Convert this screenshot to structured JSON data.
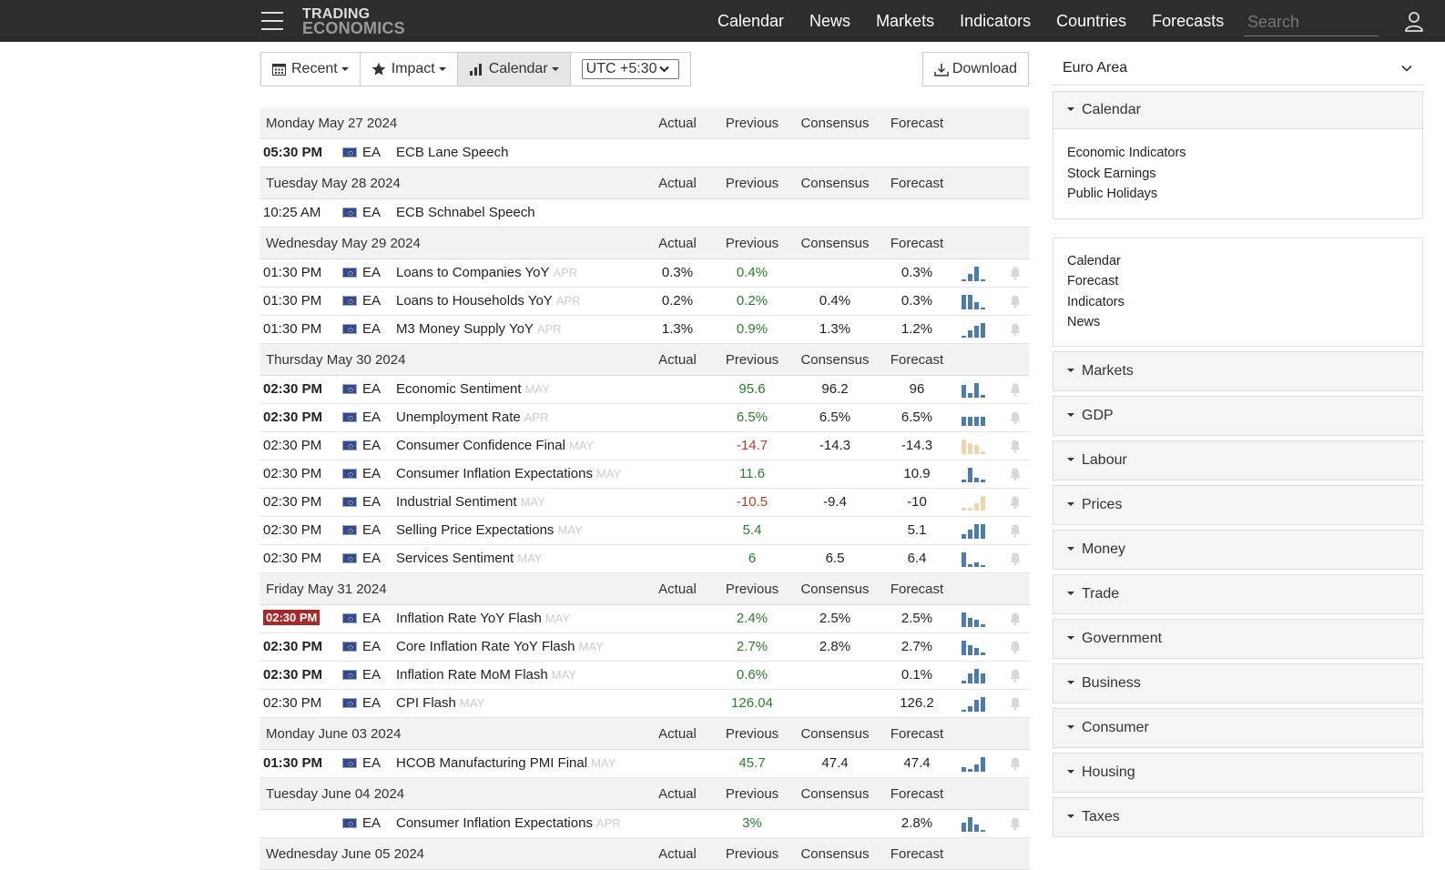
{
  "nav": {
    "logo_line1": "TRADING",
    "logo_line2": "ECONOMICS",
    "links": [
      "Calendar",
      "News",
      "Markets",
      "Indicators",
      "Countries",
      "Forecasts"
    ],
    "search_placeholder": "Search"
  },
  "toolbar": {
    "recent": "Recent",
    "impact": "Impact",
    "calendar": "Calendar",
    "timezone": "UTC +5:30",
    "download": "Download"
  },
  "columns": {
    "actual": "Actual",
    "previous": "Previous",
    "consensus": "Consensus",
    "forecast": "Forecast"
  },
  "days": [
    {
      "date": "Monday May 27 2024",
      "events": [
        {
          "time": "05:30 PM",
          "bold": true,
          "cc": "EA",
          "name": "ECB Lane Speech",
          "ref": "",
          "actual": "",
          "previous": "",
          "prev_color": "",
          "consensus": "",
          "forecast": "",
          "spark": [],
          "spark_neg": false,
          "bell": false
        }
      ]
    },
    {
      "date": "Tuesday May 28 2024",
      "events": [
        {
          "time": "10:25 AM",
          "bold": false,
          "cc": "EA",
          "name": "ECB Schnabel Speech",
          "ref": "",
          "actual": "",
          "previous": "",
          "prev_color": "",
          "consensus": "",
          "forecast": "",
          "spark": [],
          "spark_neg": false,
          "bell": false
        }
      ]
    },
    {
      "date": "Wednesday May 29 2024",
      "events": [
        {
          "time": "01:30 PM",
          "bold": false,
          "cc": "EA",
          "name": "Loans to Companies YoY",
          "ref": "APR",
          "actual": "0.3%",
          "previous": "0.4%",
          "prev_color": "green",
          "consensus": "",
          "forecast": "0.3%",
          "spark": [
            0.15,
            0.5,
            1,
            0.1
          ],
          "spark_neg": false,
          "bell": true
        },
        {
          "time": "01:30 PM",
          "bold": false,
          "cc": "EA",
          "name": "Loans to Households YoY",
          "ref": "APR",
          "actual": "0.2%",
          "previous": "0.2%",
          "prev_color": "green",
          "consensus": "0.4%",
          "forecast": "0.3%",
          "spark": [
            1,
            1,
            0.5,
            0.1
          ],
          "spark_neg": false,
          "bell": true
        },
        {
          "time": "01:30 PM",
          "bold": false,
          "cc": "EA",
          "name": "M3 Money Supply YoY",
          "ref": "APR",
          "actual": "1.3%",
          "previous": "0.9%",
          "prev_color": "green",
          "consensus": "1.3%",
          "forecast": "1.2%",
          "spark": [
            0.1,
            0.5,
            0.8,
            1
          ],
          "spark_neg": false,
          "bell": true
        }
      ]
    },
    {
      "date": "Thursday May 30 2024",
      "events": [
        {
          "time": "02:30 PM",
          "bold": true,
          "cc": "EA",
          "name": "Economic Sentiment",
          "ref": "MAY",
          "actual": "",
          "previous": "95.6",
          "prev_color": "green",
          "consensus": "96.2",
          "forecast": "96",
          "spark": [
            0.9,
            0.3,
            1,
            0.2
          ],
          "spark_neg": false,
          "bell": true
        },
        {
          "time": "02:30 PM",
          "bold": true,
          "cc": "EA",
          "name": "Unemployment Rate",
          "ref": "APR",
          "actual": "",
          "previous": "6.5%",
          "prev_color": "green",
          "consensus": "6.5%",
          "forecast": "6.5%",
          "spark": [
            0.6,
            0.6,
            0.6,
            0.6
          ],
          "spark_neg": false,
          "bell": true
        },
        {
          "time": "02:30 PM",
          "bold": false,
          "cc": "EA",
          "name": "Consumer Confidence Final",
          "ref": "MAY",
          "actual": "",
          "previous": "-14.7",
          "prev_color": "red",
          "consensus": "-14.3",
          "forecast": "-14.3",
          "spark": [
            1,
            0.75,
            0.6,
            0.2
          ],
          "spark_neg": true,
          "bell": true
        },
        {
          "time": "02:30 PM",
          "bold": false,
          "cc": "EA",
          "name": "Consumer Inflation Expectations",
          "ref": "MAY",
          "actual": "",
          "previous": "11.6",
          "prev_color": "green",
          "consensus": "",
          "forecast": "10.9",
          "spark": [
            0.2,
            1,
            0.3,
            0.2
          ],
          "spark_neg": false,
          "bell": true
        },
        {
          "time": "02:30 PM",
          "bold": false,
          "cc": "EA",
          "name": "Industrial Sentiment",
          "ref": "MAY",
          "actual": "",
          "previous": "-10.5",
          "prev_color": "red",
          "consensus": "-9.4",
          "forecast": "-10",
          "spark": [
            0.2,
            0.2,
            0.5,
            1
          ],
          "spark_neg": true,
          "bell": true
        },
        {
          "time": "02:30 PM",
          "bold": false,
          "cc": "EA",
          "name": "Selling Price Expectations",
          "ref": "MAY",
          "actual": "",
          "previous": "5.4",
          "prev_color": "green",
          "consensus": "",
          "forecast": "5.1",
          "spark": [
            0.3,
            0.6,
            1,
            1
          ],
          "spark_neg": false,
          "bell": true
        },
        {
          "time": "02:30 PM",
          "bold": false,
          "cc": "EA",
          "name": "Services Sentiment",
          "ref": "MAY",
          "actual": "",
          "previous": "6",
          "prev_color": "green",
          "consensus": "6.5",
          "forecast": "6.4",
          "spark": [
            1,
            0.2,
            0.3,
            0.1
          ],
          "spark_neg": false,
          "bell": true
        }
      ]
    },
    {
      "date": "Friday May 31 2024",
      "events": [
        {
          "time": "02:30 PM",
          "bold": true,
          "highlight": true,
          "cc": "EA",
          "name": "Inflation Rate YoY Flash",
          "ref": "MAY",
          "actual": "",
          "previous": "2.4%",
          "prev_color": "green",
          "consensus": "2.5%",
          "forecast": "2.5%",
          "spark": [
            1,
            0.6,
            0.5,
            0.2
          ],
          "spark_neg": false,
          "bell": true
        },
        {
          "time": "02:30 PM",
          "bold": true,
          "cc": "EA",
          "name": "Core Inflation Rate YoY Flash",
          "ref": "MAY",
          "actual": "",
          "previous": "2.7%",
          "prev_color": "green",
          "consensus": "2.8%",
          "forecast": "2.7%",
          "spark": [
            1,
            0.7,
            0.5,
            0.2
          ],
          "spark_neg": false,
          "bell": true
        },
        {
          "time": "02:30 PM",
          "bold": true,
          "cc": "EA",
          "name": "Inflation Rate MoM Flash",
          "ref": "MAY",
          "actual": "",
          "previous": "0.6%",
          "prev_color": "green",
          "consensus": "",
          "forecast": "0.1%",
          "spark": [
            0.2,
            0.7,
            1,
            0.7
          ],
          "spark_neg": false,
          "bell": true
        },
        {
          "time": "02:30 PM",
          "bold": false,
          "cc": "EA",
          "name": "CPI Flash",
          "ref": "MAY",
          "actual": "",
          "previous": "126.04",
          "prev_color": "green",
          "consensus": "",
          "forecast": "126.2",
          "spark": [
            0.1,
            0.4,
            0.8,
            1
          ],
          "spark_neg": false,
          "bell": true
        }
      ]
    },
    {
      "date": "Monday June 03 2024",
      "events": [
        {
          "time": "01:30 PM",
          "bold": true,
          "cc": "EA",
          "name": "HCOB Manufacturing PMI Final",
          "ref": "MAY",
          "actual": "",
          "previous": "45.7",
          "prev_color": "green",
          "consensus": "47.4",
          "forecast": "47.4",
          "spark": [
            0.3,
            0.2,
            0.5,
            1
          ],
          "spark_neg": false,
          "bell": true
        }
      ]
    },
    {
      "date": "Tuesday June 04 2024",
      "events": [
        {
          "time": "",
          "bold": false,
          "cc": "EA",
          "name": "Consumer Inflation Expectations",
          "ref": "APR",
          "actual": "",
          "previous": "3%",
          "prev_color": "green",
          "consensus": "",
          "forecast": "2.8%",
          "spark": [
            0.6,
            1,
            0.5,
            0.1
          ],
          "spark_neg": false,
          "bell": true
        }
      ]
    },
    {
      "date": "Wednesday June 05 2024",
      "events": []
    }
  ],
  "sidebar": {
    "country": "Euro Area",
    "calendar_title": "Calendar",
    "calendar_links": [
      "Economic Indicators",
      "Stock Earnings",
      "Public Holidays"
    ],
    "links": [
      "Calendar",
      "Forecast",
      "Indicators",
      "News"
    ],
    "sections": [
      "Markets",
      "GDP",
      "Labour",
      "Prices",
      "Money",
      "Trade",
      "Government",
      "Business",
      "Consumer",
      "Housing",
      "Taxes"
    ]
  }
}
